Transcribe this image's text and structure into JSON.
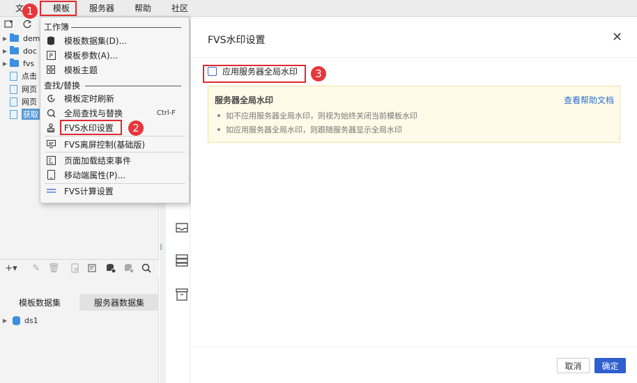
{
  "menubar": {
    "items": [
      "文",
      "模板",
      "服务器",
      "帮助",
      "社区"
    ]
  },
  "left_tree": {
    "items": [
      {
        "label": "dem",
        "type": "folder"
      },
      {
        "label": "doc",
        "type": "folder"
      },
      {
        "label": "fvs",
        "type": "folder"
      },
      {
        "label": "点击",
        "type": "file"
      },
      {
        "label": "网页",
        "type": "file"
      },
      {
        "label": "网页",
        "type": "file"
      },
      {
        "label": "获取",
        "type": "file",
        "selected": true
      }
    ]
  },
  "dataset_tabs": {
    "template_dataset": "模板数据集",
    "server_dataset": "服务器数据集"
  },
  "datasets": [
    {
      "label": "ds1"
    }
  ],
  "dropdown": {
    "section_workbook": "工作簿",
    "section_find": "查找/替换",
    "items": [
      {
        "label": "模板数据集(D)...",
        "icon": "database-icon"
      },
      {
        "label": "模板参数(A)...",
        "icon": "parameter-icon"
      },
      {
        "label": "模板主题",
        "icon": "theme-icon"
      },
      {
        "label": "模板定时刷新",
        "icon": "refresh-clock-icon"
      },
      {
        "label": "全局查找与替换",
        "icon": "find-replace-icon",
        "shortcut": "Ctrl-F"
      },
      {
        "label": "FVS水印设置",
        "icon": "stamp-icon"
      },
      {
        "label": "FVS离屏控制(基础版)",
        "icon": "screen-icon"
      },
      {
        "label": "页面加载结束事件",
        "icon": "page-event-icon"
      },
      {
        "label": "移动端属性(P)...",
        "icon": "mobile-icon"
      },
      {
        "label": "FVS计算设置",
        "icon": "calc-icon"
      }
    ]
  },
  "markers": [
    "1",
    "2",
    "3"
  ],
  "dialog": {
    "title": "FVS水印设置",
    "checkbox_label": "应用服务器全局水印",
    "checkbox_checked": false,
    "notice": {
      "title": "服务器全局水印",
      "help_link": "查看帮助文档",
      "bullets": [
        "如不应用服务器全局水印，则视为始终关闭当前模板水印",
        "如应用服务器全局水印，则跟随服务器显示全局水印"
      ]
    },
    "cancel_label": "取消",
    "ok_label": "确定"
  },
  "colors": {
    "accent": "#2f5fd0",
    "highlight": "#e0282e",
    "notice_bg": "#fffbe8",
    "folder": "#3d8fe0"
  }
}
